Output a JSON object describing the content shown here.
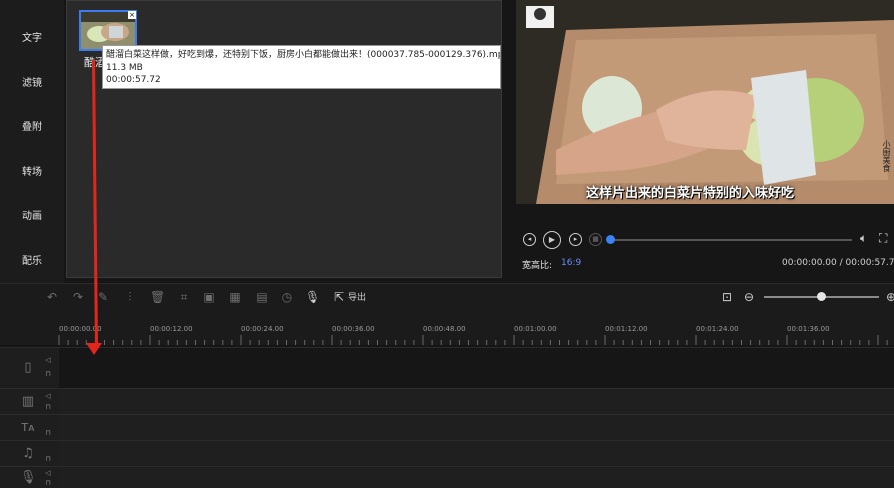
{
  "left_nav": {
    "items": [
      "文字",
      "滤镜",
      "叠附",
      "转场",
      "动画",
      "配乐"
    ]
  },
  "media": {
    "clip_label": "酷酒",
    "tooltip": {
      "filename": "醋溜白菜这样做，好吃到爆，还特别下饭，厨房小白都能做出来！(000037.785-000129.376).mp4",
      "size": "11.3  MB",
      "duration": "00:00:57.72"
    }
  },
  "preview": {
    "subtitle": "这样片出来的白菜片特别的入味好吃",
    "watermark": "小厨美食",
    "aspect_label": "宽高比:",
    "aspect_value": "16:9",
    "timecode": "00:00:00.00 / 00:00:57.72",
    "progress": 0.0
  },
  "toolbar": {
    "export_label": "导出",
    "icons": [
      "undo-icon",
      "redo-icon",
      "edit-icon",
      "split-icon",
      "delete-icon",
      "crop-icon",
      "freeze-icon",
      "mosaic-icon",
      "audio-icon",
      "speed-icon",
      "mic-icon",
      "export-icon"
    ],
    "zoom_level": 0.7
  },
  "timeline": {
    "ticks": [
      "00:00:00.00",
      "00:00:12.00",
      "00:00:24.00",
      "00:00:36.00",
      "00:00:48.00",
      "00:01:00.00",
      "00:01:12.00",
      "00:01:24.00",
      "00:01:36.00"
    ]
  },
  "colors": {
    "accent": "#3b82f6",
    "aspect_value": "#6b8cff",
    "annotation_arrow": "#e3261c"
  }
}
